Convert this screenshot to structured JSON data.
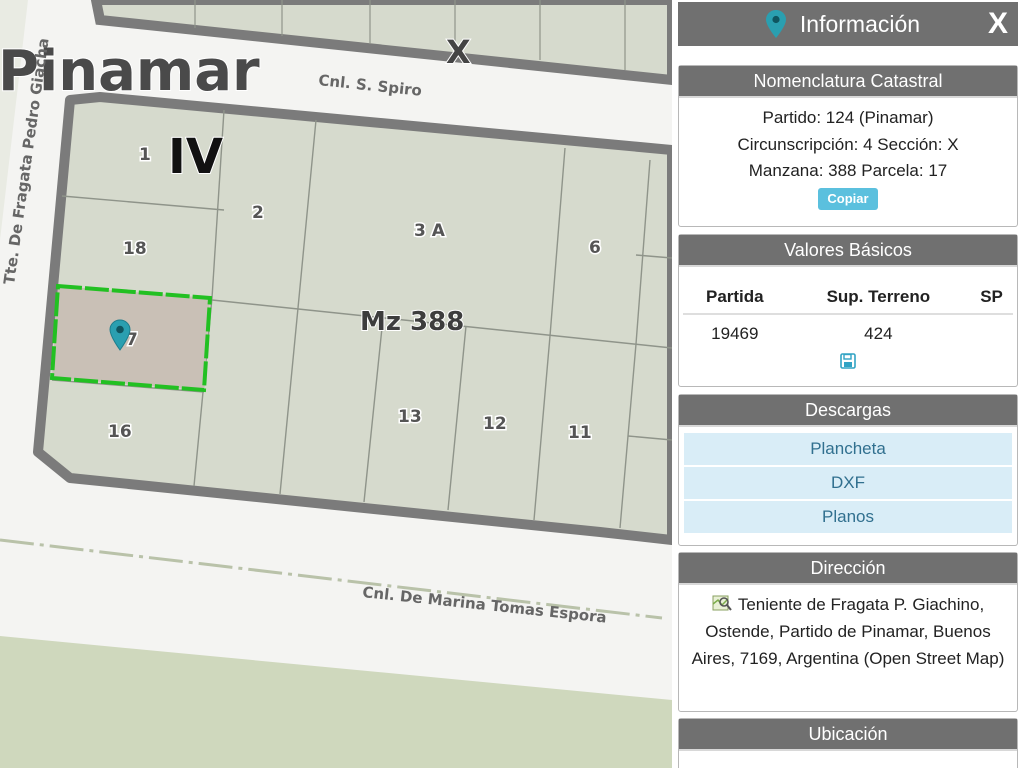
{
  "map": {
    "city_label": "Pinamar",
    "section_label": "X",
    "block_roman": "IV",
    "block_label": "Mz 388",
    "streets": {
      "top": "Cnl. S. Spiro",
      "left": "Tte. De Fragata Pedro Giacha",
      "bottom": "Cnl. De Marina Tomas Espora"
    },
    "parcels": [
      "1",
      "2",
      "3 A",
      "6",
      "18",
      "7",
      "16",
      "13",
      "12",
      "11"
    ],
    "colors": {
      "block_fill": "#d6dacd",
      "block_border": "#7b7b7b",
      "selected_outline": "#22c022",
      "selected_fill": "#c9c0b6",
      "marker": "#2a9fb0",
      "park": "#cfd8bd"
    },
    "icons": {
      "marker": "map-marker-icon"
    }
  },
  "panel": {
    "header": {
      "title": "Información",
      "close": "X",
      "icon": "map-marker-icon"
    },
    "nomenclatura": {
      "title": "Nomenclatura Catastral",
      "line1": "Partido: 124 (Pinamar)",
      "line2": "Circunscripción: 4 Sección: X",
      "line3": "Manzana: 388 Parcela: 17",
      "copy_button": "Copiar"
    },
    "valores": {
      "title": "Valores Básicos",
      "headers": [
        "Partida",
        "Sup. Terreno",
        "SP"
      ],
      "row": [
        "19469",
        "424",
        ""
      ],
      "icon": "save-icon"
    },
    "descargas": {
      "title": "Descargas",
      "items": [
        "Plancheta",
        "DXF",
        "Planos"
      ]
    },
    "direccion": {
      "title": "Dirección",
      "text": "Teniente de Fragata P. Giachino, Ostende, Partido de Pinamar, Buenos Aires, 7169, Argentina (Open Street Map)",
      "icon": "map-search-icon"
    },
    "ubicacion": {
      "title": "Ubicación"
    },
    "accent_color": "#5bc0de",
    "header_color": "#707070"
  }
}
